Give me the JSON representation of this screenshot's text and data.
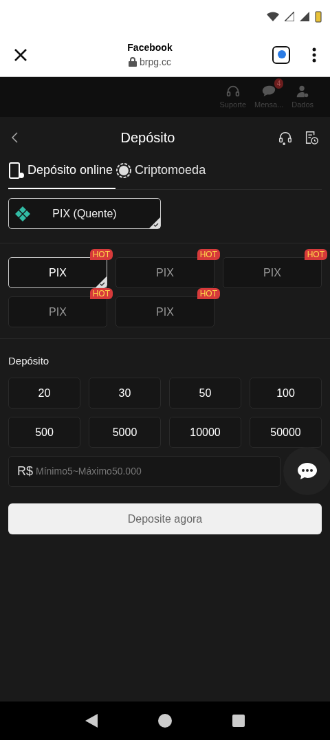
{
  "browser": {
    "title": "Facebook",
    "url": "brpg.cc"
  },
  "background_header": {
    "items": [
      {
        "kind": "support",
        "label": "Suporte"
      },
      {
        "kind": "message",
        "label": "Mensa...",
        "badge": "4"
      },
      {
        "kind": "profile",
        "label": "Dados"
      }
    ]
  },
  "page": {
    "title": "Depósito"
  },
  "tabs": [
    {
      "kind": "online",
      "label": "Depósito online",
      "selected": true
    },
    {
      "kind": "crypto",
      "label": "Criptomoeda",
      "selected": false
    }
  ],
  "channels": [
    {
      "label": "PIX (Quente)",
      "selected": true
    }
  ],
  "methods": [
    {
      "label": "PIX",
      "badge": "HOT",
      "selected": true
    },
    {
      "label": "PIX",
      "badge": "HOT",
      "selected": false
    },
    {
      "label": "PIX",
      "badge": "HOT",
      "selected": false
    },
    {
      "label": "PIX",
      "badge": "HOT",
      "selected": false
    },
    {
      "label": "PIX",
      "badge": "HOT",
      "selected": false
    }
  ],
  "amount_section": {
    "title": "Depósito",
    "amounts": [
      "20",
      "30",
      "50",
      "100",
      "500",
      "5000",
      "10000",
      "50000"
    ],
    "currency": "R$",
    "placeholder": "Mínimo5~Máximo50.000"
  },
  "submit": {
    "label": "Deposite agora"
  }
}
